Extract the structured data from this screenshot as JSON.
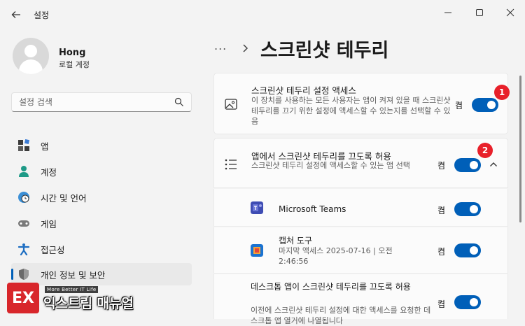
{
  "window": {
    "title": "설정",
    "minimize_icon": "minimize-icon",
    "maximize_icon": "maximize-icon",
    "close_icon": "close-icon"
  },
  "user": {
    "name": "Hong",
    "account_type": "로컬 계정"
  },
  "search": {
    "placeholder": "설정 검색"
  },
  "sidebar": {
    "items": [
      {
        "label": "앱",
        "icon": "apps-icon"
      },
      {
        "label": "계정",
        "icon": "account-icon"
      },
      {
        "label": "시간 및 언어",
        "icon": "time-language-icon"
      },
      {
        "label": "게임",
        "icon": "gaming-icon"
      },
      {
        "label": "접근성",
        "icon": "accessibility-icon"
      },
      {
        "label": "개인 정보 및 보안",
        "icon": "shield-icon",
        "active": true
      }
    ]
  },
  "watermark": {
    "logo_letter": "EX",
    "tagline": "More Better IT Life",
    "name": "익스트림 매뉴얼"
  },
  "breadcrumb": {
    "more": "...",
    "title": "스크린샷 테두리"
  },
  "settings": {
    "access": {
      "title": "스크린샷 테두리 설정 액세스",
      "description": "이 장치를 사용하는 모든 사용자는 앱이 켜져 있을 때 스크린샷 테두리를 끄기 위한 설정에 액세스할 수 있는지를 선택할 수 있음",
      "state": "켬",
      "on": true,
      "badge": "1"
    },
    "apps_allow": {
      "title": "앱에서 스크린샷 테두리를 끄도록 허용",
      "description": "스크린샷 테두리 설정에 액세스할 수 있는 앱 선택",
      "state": "켬",
      "on": true,
      "badge": "2",
      "expanded": true
    },
    "apps": [
      {
        "name": "Microsoft Teams",
        "state": "켬",
        "on": true
      },
      {
        "name": "캡처 도구",
        "meta": "마지막 액세스 2025-07-16 | 오전 2:46:56",
        "state": "켬",
        "on": true
      },
      {
        "name": "데스크톱 앱이 스크린샷 테두리를 끄도록 허용",
        "meta": "이전에 스크린샷 테두리 설정에 대한 액세스를 요청한 데스크톱 앱 열거에 나열됩니다",
        "state": "켬",
        "on": true
      }
    ]
  },
  "colors": {
    "accent": "#005fb8",
    "badge": "#e8202a",
    "logo": "#d8262b"
  }
}
